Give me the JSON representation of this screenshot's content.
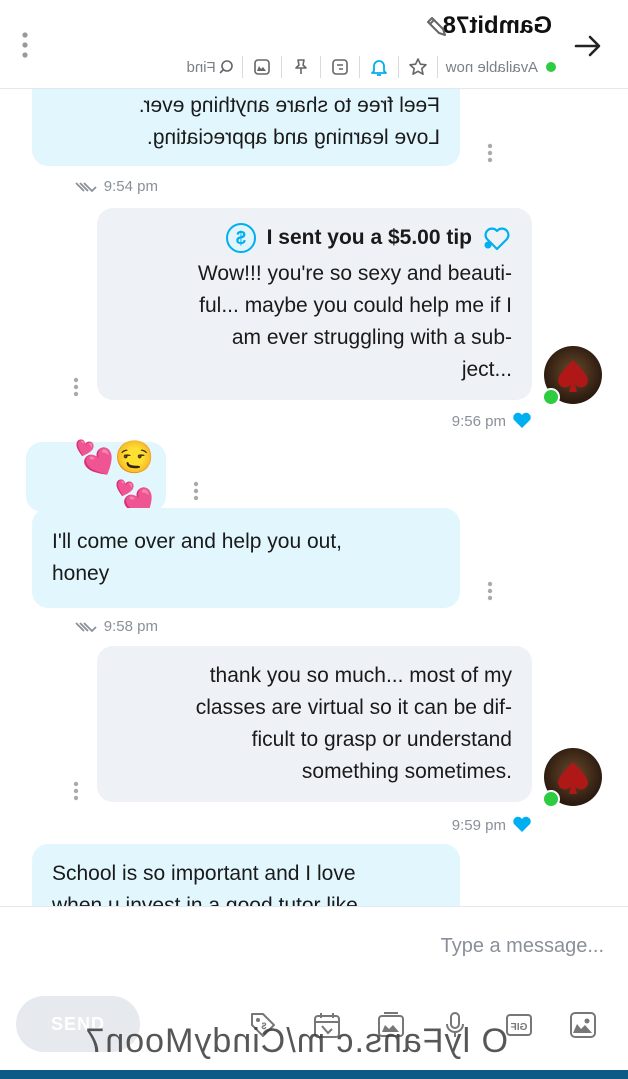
{
  "header": {
    "username": "Gambit78",
    "status": "Available now",
    "find_label": "Find",
    "icons": [
      "back-arrow-icon",
      "edit-icon",
      "star-icon",
      "bell-icon",
      "tag-icon",
      "pin-icon",
      "image-icon",
      "search-icon",
      "more-icon"
    ]
  },
  "colors": {
    "outgoing_bubble": "#e2f7fd",
    "incoming_bubble": "#eef1f5",
    "accent": "#00aff0",
    "online": "#2ecc40"
  },
  "messages": [
    {
      "id": "m1",
      "direction": "out",
      "text": "Feel free to share anything ever.\nLove learning and appreciating.",
      "time": "9:54 pm"
    },
    {
      "id": "m2",
      "direction": "in",
      "tip": "I sent you a $5.00 tip",
      "text": "Wow!!! you're so sexy and beauti-\nful... maybe you could help me if I\nam ever struggling with a sub-\nject...",
      "time": "9:56 pm"
    },
    {
      "id": "m3",
      "direction": "out",
      "text": "😏💕💕",
      "time": ""
    },
    {
      "id": "m4",
      "direction": "out",
      "text": "I'll come over and help you out,\nhoney",
      "time": "9:58 pm"
    },
    {
      "id": "m5",
      "direction": "in",
      "text": "thank you so much... most of my\nclasses are virtual so it can be dif-\nficult to grasp or understand\nsomething sometimes.",
      "time": "9:59 pm"
    },
    {
      "id": "m6",
      "direction": "out",
      "text": "School is so important and I love\nwhen u invest in a good tutor like",
      "time": ""
    }
  ],
  "composer": {
    "placeholder": "Type a message...",
    "send_label": "SEND",
    "tools": [
      "image-icon",
      "gif-icon",
      "microphone-icon",
      "media-icon",
      "calendar-icon",
      "price-tag-icon"
    ]
  },
  "watermark": "O lyFans.c m/CindyMoon7"
}
